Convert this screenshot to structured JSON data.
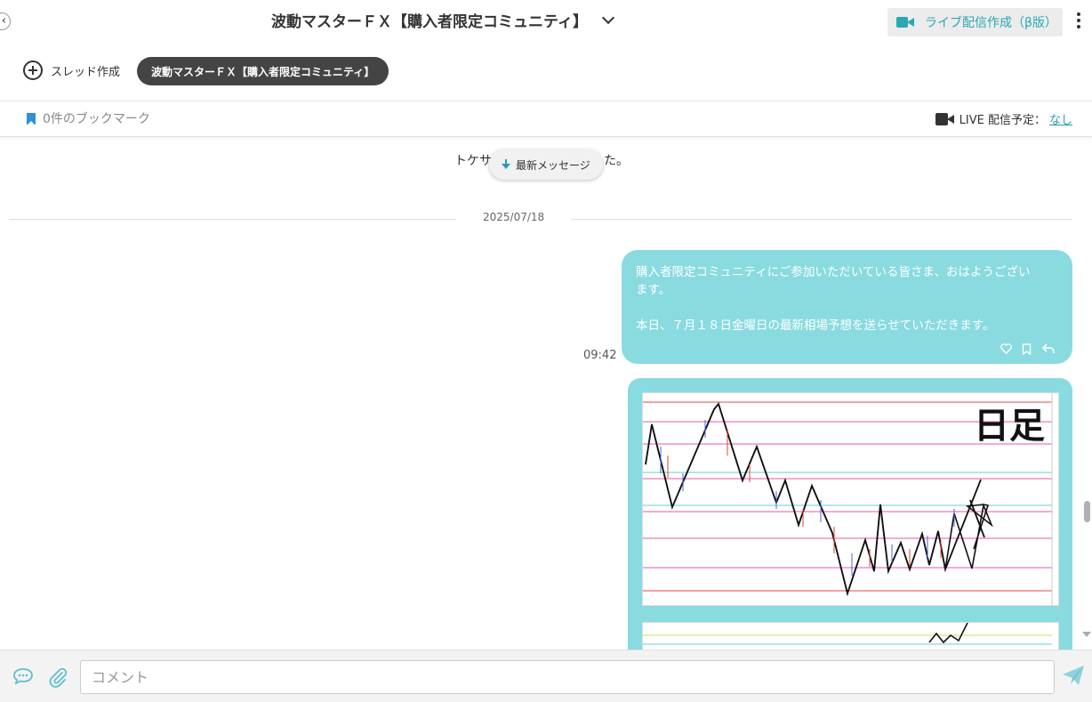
{
  "header": {
    "title": "波動マスターＦＸ【購入者限定コミュニティ】",
    "live_create_label": "ライブ配信作成（β版）",
    "thread_create_label": "スレッド作成",
    "thread_chip_label": "波動マスターＦＸ【購入者限定コミュニティ】",
    "bookmark_label": "0件のブックマーク",
    "live_schedule_label": "LIVE 配信予定：",
    "live_schedule_value": "なし"
  },
  "chat": {
    "system_message": "トケサ",
    "system_message_tail": "た。",
    "latest_button_label": "最新メッセージ",
    "date_separator": "2025/07/18",
    "messages": [
      {
        "time": "09:42",
        "line1": "購入者限定コミュニティにご参加いただいている皆さま、おはようござい",
        "line2": "ます。",
        "line3": "本日、７月１８日金曜日の最新相場予想を送らせていただきます。"
      }
    ],
    "chart_caption": "日足"
  },
  "composer": {
    "placeholder": "コメント"
  },
  "colors": {
    "bubble": "#89dbe0",
    "accent": "#2aa8b3",
    "chip": "#444444"
  }
}
